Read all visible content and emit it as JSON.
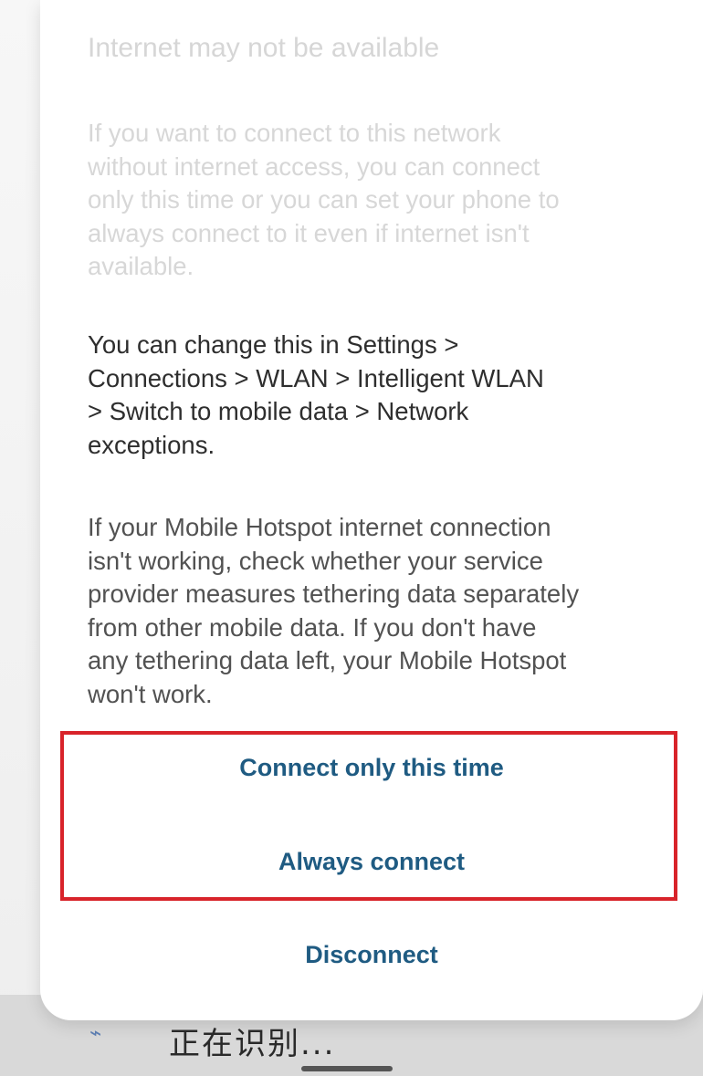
{
  "dialog": {
    "title": "Internet may not be available",
    "paragraphs": [
      "If you want to connect to this network\nwithout internet access, you can connect\nonly this time or you can set your phone to\nalways connect to it even if internet isn't\navailable.",
      "You can change this in Settings >\nConnections > WLAN > Intelligent WLAN\n> Switch to mobile data > Network\nexceptions.",
      "If your Mobile Hotspot internet connection\nisn't working, check whether your service\nprovider measures tethering data separately\nfrom other mobile data. If you don't have\nany tethering data left, your Mobile Hotspot\nwon't work."
    ],
    "actions": {
      "connect_once": "Connect only this time",
      "always_connect": "Always connect",
      "disconnect": "Disconnect"
    }
  },
  "background": {
    "partial_row_text": "正在识别..."
  },
  "colors": {
    "action_text": "#1f5b82",
    "highlight_border": "#d8232a",
    "dialog_bg": "#ffffff"
  },
  "icons": {
    "partial_row_icon": "phone-link-icon"
  }
}
